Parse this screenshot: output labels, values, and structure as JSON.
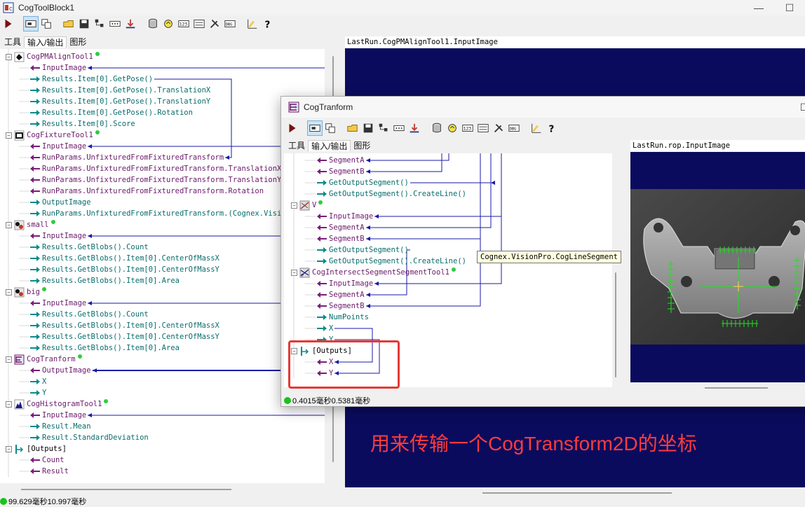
{
  "main_window": {
    "title": "CogToolBlock1",
    "buttons": {
      "minimize": "—",
      "maximize": "☐"
    },
    "tabs": [
      "工具",
      "输入/输出",
      "图形"
    ],
    "tree": [
      {
        "kind": "tool",
        "icon": "pmalign-icon",
        "label": "CogPMAlignTool1"
      },
      {
        "kind": "in",
        "label": "InputImage"
      },
      {
        "kind": "out",
        "label": "Results.Item[0].GetPose()"
      },
      {
        "kind": "out",
        "label": "Results.Item[0].GetPose().TranslationX"
      },
      {
        "kind": "out",
        "label": "Results.Item[0].GetPose().TranslationY"
      },
      {
        "kind": "out",
        "label": "Results.Item[0].GetPose().Rotation"
      },
      {
        "kind": "out",
        "label": "Results.Item[0].Score"
      },
      {
        "kind": "tool",
        "icon": "fixture-icon",
        "label": "CogFixtureTool1"
      },
      {
        "kind": "in",
        "label": "InputImage"
      },
      {
        "kind": "in",
        "label": "RunParams.UnfixturedFromFixturedTransform"
      },
      {
        "kind": "in",
        "label": "RunParams.UnfixturedFromFixturedTransform.TranslationX"
      },
      {
        "kind": "in",
        "label": "RunParams.UnfixturedFromFixturedTransform.TranslationY"
      },
      {
        "kind": "in",
        "label": "RunParams.UnfixturedFromFixturedTransform.Rotation"
      },
      {
        "kind": "out",
        "label": "OutputImage"
      },
      {
        "kind": "out",
        "label": "RunParams.UnfixturedFromFixturedTransform.(Cognex.VisionPro"
      },
      {
        "kind": "tool",
        "icon": "blob-icon",
        "label": "small"
      },
      {
        "kind": "in",
        "label": "InputImage"
      },
      {
        "kind": "out",
        "label": "Results.GetBlobs().Count"
      },
      {
        "kind": "out",
        "label": "Results.GetBlobs().Item[0].CenterOfMassX"
      },
      {
        "kind": "out",
        "label": "Results.GetBlobs().Item[0].CenterOfMassY"
      },
      {
        "kind": "out",
        "label": "Results.GetBlobs().Item[0].Area"
      },
      {
        "kind": "tool",
        "icon": "blob-icon",
        "label": "big"
      },
      {
        "kind": "in",
        "label": "InputImage"
      },
      {
        "kind": "out",
        "label": "Results.GetBlobs().Count"
      },
      {
        "kind": "out",
        "label": "Results.GetBlobs().Item[0].CenterOfMassX"
      },
      {
        "kind": "out",
        "label": "Results.GetBlobs().Item[0].CenterOfMassY"
      },
      {
        "kind": "out",
        "label": "Results.GetBlobs().Item[0].Area"
      },
      {
        "kind": "tool",
        "icon": "transform-icon",
        "label": "CogTranform"
      },
      {
        "kind": "in",
        "label": "OutputImage"
      },
      {
        "kind": "out",
        "label": "X"
      },
      {
        "kind": "out",
        "label": "Y"
      },
      {
        "kind": "tool",
        "icon": "histogram-icon",
        "label": "CogHistogramTool1"
      },
      {
        "kind": "in",
        "label": "InputImage"
      },
      {
        "kind": "out",
        "label": "Result.Mean"
      },
      {
        "kind": "out",
        "label": "Result.StandardDeviation"
      },
      {
        "kind": "grp",
        "icon": "outputs-icon",
        "label": "[Outputs]"
      },
      {
        "kind": "in",
        "label": "Count"
      },
      {
        "kind": "in",
        "label": "Result"
      }
    ],
    "image_header": "LastRun.CogPMAlignTool1.InputImage",
    "status": "99.629毫秒10.997毫秒",
    "caption": "用来传输一个CogTransform2D的坐标"
  },
  "dialog": {
    "title": "CogTranform",
    "buttons": {
      "maximize": "☐"
    },
    "tabs": [
      "工具",
      "输入/输出",
      "图形"
    ],
    "tree": [
      {
        "kind": "in",
        "label": "SegmentA"
      },
      {
        "kind": "in",
        "label": "SegmentB"
      },
      {
        "kind": "out",
        "label": "GetOutputSegment()"
      },
      {
        "kind": "out",
        "label": "GetOutputSegment().CreateLine()"
      },
      {
        "kind": "tool",
        "icon": "segment-icon",
        "label": "V"
      },
      {
        "kind": "in",
        "label": "InputImage"
      },
      {
        "kind": "in",
        "label": "SegmentA"
      },
      {
        "kind": "in",
        "label": "SegmentB"
      },
      {
        "kind": "out",
        "label": "GetOutputSegment()"
      },
      {
        "kind": "out",
        "label": "GetOutputSegment().CreateLine()"
      },
      {
        "kind": "tool",
        "icon": "intersect-icon",
        "label": "CogIntersectSegmentSegmentTool1"
      },
      {
        "kind": "in",
        "label": "InputImage"
      },
      {
        "kind": "in",
        "label": "SegmentA"
      },
      {
        "kind": "in",
        "label": "SegmentB"
      },
      {
        "kind": "out",
        "label": "NumPoints"
      },
      {
        "kind": "out",
        "label": "X"
      },
      {
        "kind": "out",
        "label": "Y"
      },
      {
        "kind": "grp",
        "icon": "outputs-icon",
        "label": "[Outputs]"
      },
      {
        "kind": "in",
        "label": "X"
      },
      {
        "kind": "in",
        "label": "Y"
      }
    ],
    "tooltip": "Cognex.VisionPro.CogLineSegment",
    "image_header": "LastRun.rop.InputImage",
    "status": "0.4015毫秒0.5381毫秒"
  },
  "colors": {
    "in_arrow": "#7a1d7a",
    "out_arrow": "#0a8a8a",
    "link": "#1a1aa8",
    "image_bg": "#0b0b5e",
    "highlight": "#e53935",
    "caption": "#ff3b3b"
  }
}
